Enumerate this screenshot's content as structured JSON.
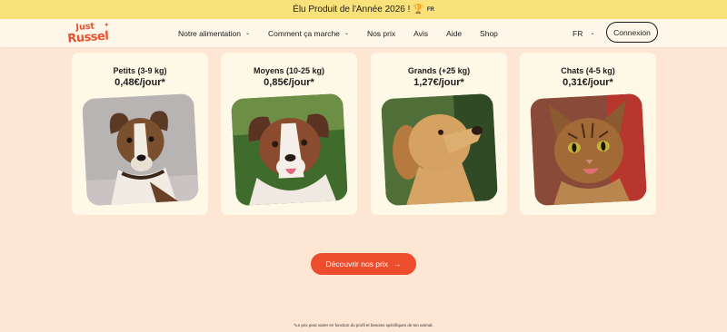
{
  "promo": {
    "text": "Élu Produit de l'Année 2026 !",
    "lang_badge": "FR",
    "icon": "trophy-icon"
  },
  "nav": {
    "logo_top": "Just",
    "logo_bottom": "Russel",
    "items": [
      {
        "label": "Notre alimentation",
        "dropdown": true
      },
      {
        "label": "Comment ça marche",
        "dropdown": true
      },
      {
        "label": "Nos prix",
        "dropdown": false
      },
      {
        "label": "Avis",
        "dropdown": false
      },
      {
        "label": "Aide",
        "dropdown": false
      },
      {
        "label": "Shop",
        "dropdown": false
      }
    ],
    "language": "FR",
    "login_label": "Connexion"
  },
  "cards": [
    {
      "name": "Petits (3-9 kg)",
      "price": "0,48€/jour*",
      "image": "small-dog-image"
    },
    {
      "name": "Moyens (10-25 kg)",
      "price": "0,85€/jour*",
      "image": "medium-dog-image"
    },
    {
      "name": "Grands (+25 kg)",
      "price": "1,27€/jour*",
      "image": "large-dog-image"
    },
    {
      "name": "Chats (4-5 kg)",
      "price": "0,31€/jour*",
      "image": "cat-image"
    }
  ],
  "cta": {
    "label": "Découvrir nos prix",
    "icon": "arrow-right-icon"
  },
  "footnote": "*Le prix peut varier en fonction du profil et besoins spécifiques de ton animal.",
  "colors": {
    "background": "#fde6d4",
    "promo_bar": "#f9e27a",
    "accent": "#ec4d2c",
    "card": "#fef8e6"
  }
}
